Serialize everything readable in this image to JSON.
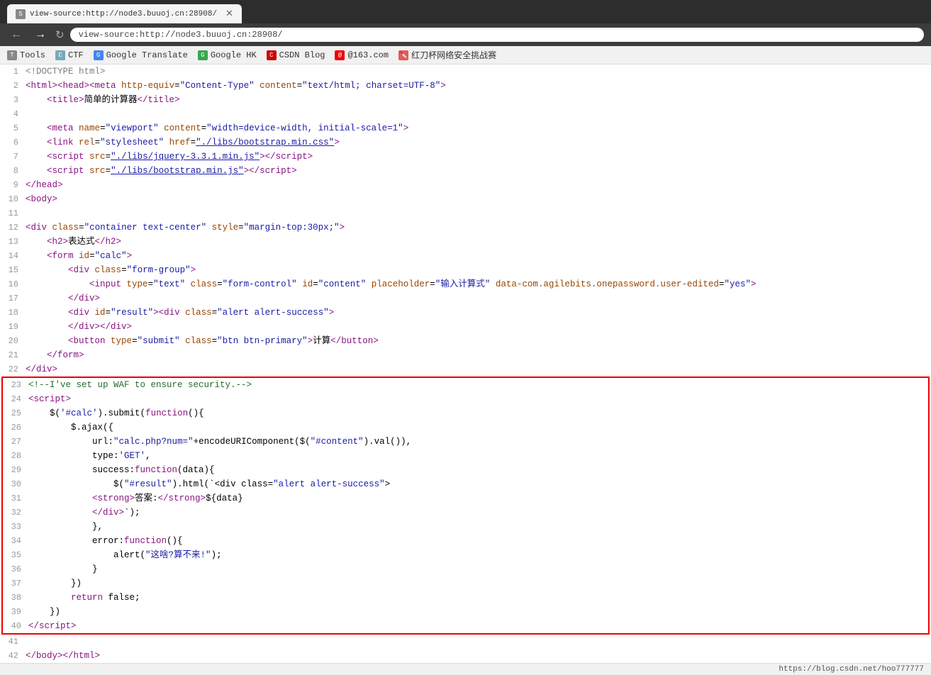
{
  "browser": {
    "tab_label": "view-source:http://node3.buuoj.cn:28908/",
    "address": "view-source:http://node3.buuoj.cn:28908/",
    "bookmarks": [
      {
        "label": "Tools",
        "icon_color": "#888"
      },
      {
        "label": "CTF",
        "icon_color": "#7ab"
      },
      {
        "label": "Google Translate",
        "icon_color": "#4285f4"
      },
      {
        "label": "Google HK",
        "icon_color": "#34a853"
      },
      {
        "label": "CSDN Blog",
        "icon_color": "#c00"
      },
      {
        "label": "@163.com",
        "icon_color": "#e00"
      },
      {
        "label": "红刀杯网络安全挑战赛",
        "icon_color": "#e55"
      }
    ],
    "status_text": "https://blog.csdn.net/hoo777777"
  },
  "code": {
    "lines": [
      {
        "num": 1,
        "html": "<span class='c-doctype'>&lt;!DOCTYPE html&gt;</span>"
      },
      {
        "num": 2,
        "html": "<span class='c-tag'>&lt;html&gt;</span><span class='c-tag'>&lt;head&gt;</span><span class='c-tag'>&lt;meta</span> <span class='c-attr'>http-equiv</span><span class='c-punct'>=</span><span class='c-string'>\"Content-Type\"</span> <span class='c-attr'>content</span><span class='c-punct'>=</span><span class='c-string'>\"text/html; charset=UTF-8\"</span><span class='c-tag'>&gt;</span>"
      },
      {
        "num": 3,
        "html": "    <span class='c-tag'>&lt;title&gt;</span><span class='c-text'>简单的计算器</span><span class='c-tag'>&lt;/title&gt;</span>"
      },
      {
        "num": 4,
        "html": ""
      },
      {
        "num": 5,
        "html": "    <span class='c-tag'>&lt;meta</span> <span class='c-attr'>name</span><span class='c-punct'>=</span><span class='c-string'>\"viewport\"</span> <span class='c-attr'>content</span><span class='c-punct'>=</span><span class='c-string'>\"width=device-width, initial-scale=1\"</span><span class='c-tag'>&gt;</span>"
      },
      {
        "num": 6,
        "html": "    <span class='c-tag'>&lt;link</span> <span class='c-attr'>rel</span><span class='c-punct'>=</span><span class='c-string'>\"stylesheet\"</span> <span class='c-attr'>href</span><span class='c-punct'>=</span><span class='c-link'>\"./libs/bootstrap.min.css\"</span><span class='c-tag'>&gt;</span>"
      },
      {
        "num": 7,
        "html": "    <span class='c-tag'>&lt;script</span> <span class='c-attr'>src</span><span class='c-punct'>=</span><span class='c-link'>\"./libs/jquery-3.3.1.min.js\"</span><span class='c-tag'>&gt;&lt;/script&gt;</span>"
      },
      {
        "num": 8,
        "html": "    <span class='c-tag'>&lt;script</span> <span class='c-attr'>src</span><span class='c-punct'>=</span><span class='c-link'>\"./libs/bootstrap.min.js\"</span><span class='c-tag'>&gt;&lt;/script&gt;</span>"
      },
      {
        "num": 9,
        "html": "<span class='c-tag'>&lt;/head&gt;</span>"
      },
      {
        "num": 10,
        "html": "<span class='c-tag'>&lt;body&gt;</span>"
      },
      {
        "num": 11,
        "html": ""
      },
      {
        "num": 12,
        "html": "<span class='c-tag'>&lt;div</span> <span class='c-attr'>class</span><span class='c-punct'>=</span><span class='c-string'>\"container text-center\"</span> <span class='c-attr'>style</span><span class='c-punct'>=</span><span class='c-string'>\"margin-top:30px;\"</span><span class='c-tag'>&gt;</span>"
      },
      {
        "num": 13,
        "html": "    <span class='c-tag'>&lt;h2&gt;</span><span class='c-text'>表达式</span><span class='c-tag'>&lt;/h2&gt;</span>"
      },
      {
        "num": 14,
        "html": "    <span class='c-tag'>&lt;form</span> <span class='c-attr'>id</span><span class='c-punct'>=</span><span class='c-string'>\"calc\"</span><span class='c-tag'>&gt;</span>"
      },
      {
        "num": 15,
        "html": "        <span class='c-tag'>&lt;div</span> <span class='c-attr'>class</span><span class='c-punct'>=</span><span class='c-string'>\"form-group\"</span><span class='c-tag'>&gt;</span>"
      },
      {
        "num": 16,
        "html": "            <span class='c-tag'>&lt;input</span> <span class='c-attr'>type</span><span class='c-punct'>=</span><span class='c-string'>\"text\"</span> <span class='c-attr'>class</span><span class='c-punct'>=</span><span class='c-string'>\"form-control\"</span> <span class='c-attr'>id</span><span class='c-punct'>=</span><span class='c-string'>\"content\"</span> <span class='c-attr'>placeholder</span><span class='c-punct'>=</span><span class='c-string'>\"输入计算式\"</span> <span class='c-attr'>data-com.agilebits.onepassword.user-edited</span><span class='c-punct'>=</span><span class='c-string'>\"yes\"</span><span class='c-tag'>&gt;</span>"
      },
      {
        "num": 17,
        "html": "        <span class='c-tag'>&lt;/div&gt;</span>"
      },
      {
        "num": 18,
        "html": "        <span class='c-tag'>&lt;div</span> <span class='c-attr'>id</span><span class='c-punct'>=</span><span class='c-string'>\"result\"</span><span class='c-tag'>&gt;</span><span class='c-tag'>&lt;div</span> <span class='c-attr'>class</span><span class='c-punct'>=</span><span class='c-string'>\"alert alert-success\"</span><span class='c-tag'>&gt;</span>"
      },
      {
        "num": 19,
        "html": "        <span class='c-tag'>&lt;/div&gt;&lt;/div&gt;</span>"
      },
      {
        "num": 20,
        "html": "        <span class='c-tag'>&lt;button</span> <span class='c-attr'>type</span><span class='c-punct'>=</span><span class='c-string'>\"submit\"</span> <span class='c-attr'>class</span><span class='c-punct'>=</span><span class='c-string'>\"btn btn-primary\"</span><span class='c-tag'>&gt;</span><span class='c-text'>计算</span><span class='c-tag'>&lt;/button&gt;</span>"
      },
      {
        "num": 21,
        "html": "    <span class='c-tag'>&lt;/form&gt;</span>"
      },
      {
        "num": 22,
        "html": "<span class='c-tag'>&lt;/div&gt;</span>"
      }
    ],
    "highlighted_lines": [
      {
        "num": 23,
        "html": "<span class='c-comment'>&lt;!--I've set up WAF to ensure security.--&gt;</span>"
      },
      {
        "num": 24,
        "html": "<span class='c-tag'>&lt;script&gt;</span>"
      },
      {
        "num": 25,
        "html": "    <span class='c-js-fn'>$(</span><span class='c-js-str'>'#calc'</span><span class='c-js-fn'>).submit(</span><span class='c-js-kw'>function</span><span class='c-js-fn'>(){</span>"
      },
      {
        "num": 26,
        "html": "        <span class='c-js-fn'>$.ajax({</span>"
      },
      {
        "num": 27,
        "html": "            <span class='c-js-fn'>url:</span><span class='c-js-str'>\"calc.php?num=\"</span><span class='c-js-fn'>+encodeURIComponent($(</span><span class='c-js-str'>\"#content\"</span><span class='c-js-fn'>).val()),</span>"
      },
      {
        "num": 28,
        "html": "            <span class='c-js-fn'>type:</span><span class='c-js-str'>'GET'</span><span class='c-js-fn'>,</span>"
      },
      {
        "num": 29,
        "html": "            <span class='c-js-fn'>success:</span><span class='c-js-kw'>function</span><span class='c-js-fn'>(data){</span>"
      },
      {
        "num": 30,
        "html": "                <span class='c-js-fn'>$(</span><span class='c-js-str'>\"#result\"</span><span class='c-js-fn'>).html(`&lt;div class=</span><span class='c-js-str'>\"alert alert-success\"</span><span class='c-js-fn'>&gt;</span>"
      },
      {
        "num": 31,
        "html": "            <span class='c-tag'>&lt;strong&gt;</span><span class='c-text'>答案:</span><span class='c-tag'>&lt;/strong&gt;</span><span class='c-js-fn'>${data}</span>"
      },
      {
        "num": 32,
        "html": "            <span class='c-tag'>&lt;/div&gt;</span><span class='c-js-fn'>`);"
      },
      {
        "num": 33,
        "html": "            },"
      },
      {
        "num": 34,
        "html": "            <span class='c-js-fn'>error:</span><span class='c-js-kw'>function</span><span class='c-js-fn'>(){</span>"
      },
      {
        "num": 35,
        "html": "                <span class='c-js-fn'>alert(</span><span class='c-js-str'>\"这啥?算不来!\"</span><span class='c-js-fn'>);</span>"
      },
      {
        "num": 36,
        "html": "            }"
      },
      {
        "num": 37,
        "html": "        })"
      },
      {
        "num": 38,
        "html": "        <span class='c-js-kw'>return</span> false;"
      },
      {
        "num": 39,
        "html": "    })"
      },
      {
        "num": 40,
        "html": "<span class='c-tag'>&lt;/script&gt;</span>"
      }
    ],
    "after_lines": [
      {
        "num": 41,
        "html": ""
      },
      {
        "num": 42,
        "html": "<span class='c-tag'>&lt;/body&gt;&lt;/html&gt;</span>"
      }
    ]
  }
}
